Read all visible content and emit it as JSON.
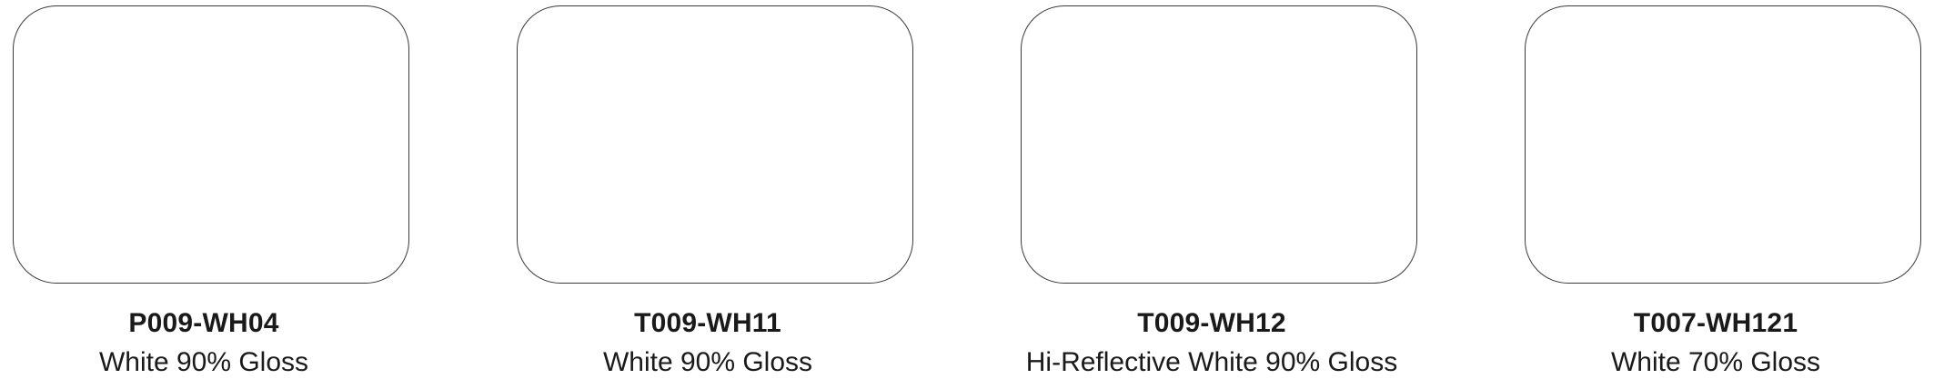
{
  "swatches": [
    {
      "code": "P009-WH04",
      "description": "White 90% Gloss",
      "color": "#ffffff"
    },
    {
      "code": "T009-WH11",
      "description": "White 90% Gloss",
      "color": "#ffffff"
    },
    {
      "code": "T009-WH12",
      "description": "Hi-Reflective White 90% Gloss",
      "color": "#ffffff"
    },
    {
      "code": "T007-WH121",
      "description": "White 70% Gloss",
      "color": "#ffffff"
    }
  ]
}
